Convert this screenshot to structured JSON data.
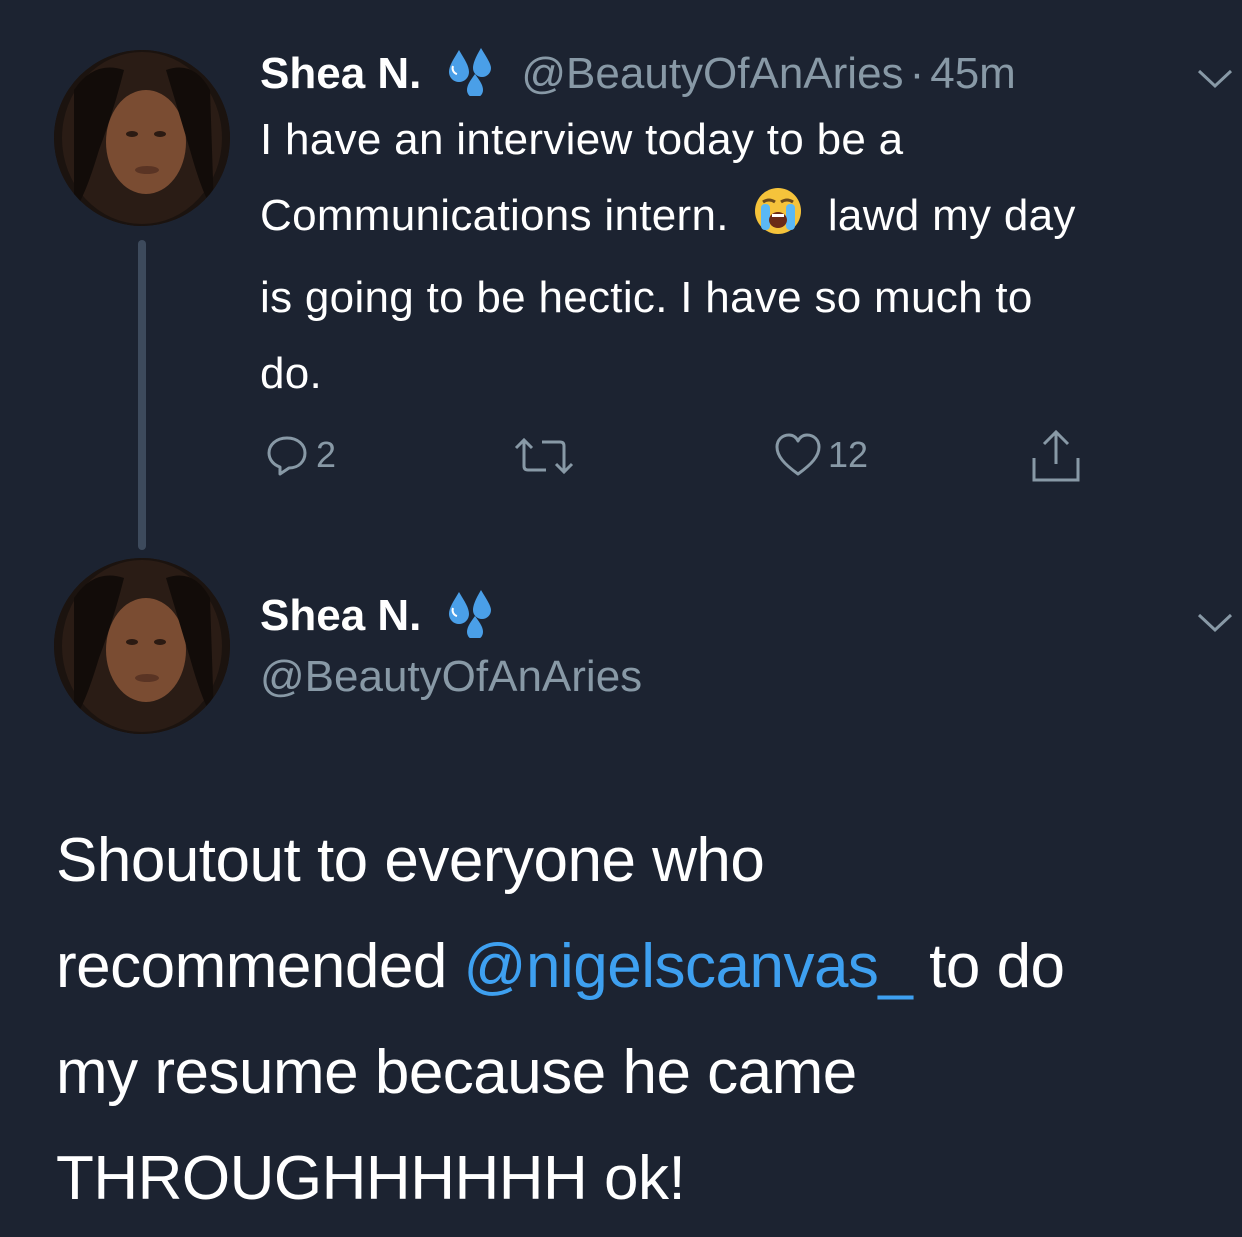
{
  "tweet1": {
    "name": "Shea N.",
    "handle": "@BeautyOfAnAries",
    "time_sep": "·",
    "time": "45m",
    "text_lines": [
      "I have an interview today to be a",
      "Communications intern.",
      "lawd my day",
      "is going to be hectic. I have so much to",
      "do."
    ],
    "emoji": "loudly-crying-face-emoji",
    "replies": "2",
    "likes": "12"
  },
  "tweet2": {
    "name": "Shea N.",
    "handle": "@BeautyOfAnAries",
    "text_lines": {
      "line1": "Shoutout to everyone who",
      "line2_pre": "recommended ",
      "mention": "@nigelscanvas_",
      "line2_post": " to do",
      "line3": "my resume because he came",
      "line4": "THROUGHHHHHH ok!"
    }
  },
  "colors": {
    "background": "#1c2331",
    "secondary_text": "#8899a6",
    "mention": "#3ea0f0",
    "droplet": "#4a9fe8"
  },
  "icons": [
    "droplets-icon",
    "chevron-down-icon",
    "reply-icon",
    "retweet-icon",
    "heart-icon",
    "share-icon"
  ]
}
